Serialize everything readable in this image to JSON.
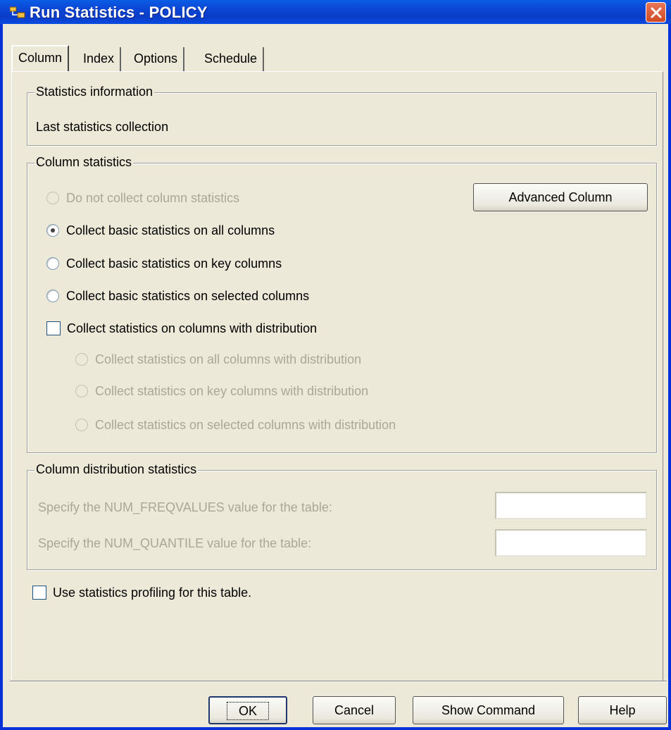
{
  "window": {
    "title": "Run Statistics - POLICY",
    "close_icon": "close-x"
  },
  "tabs": [
    {
      "label": "Column",
      "active": true
    },
    {
      "label": "Index",
      "active": false
    },
    {
      "label": "Options",
      "active": false
    },
    {
      "label": "Schedule",
      "active": false
    }
  ],
  "statistics_info": {
    "legend": "Statistics information",
    "text": "Last statistics collection"
  },
  "column_stats": {
    "legend": "Column statistics",
    "advanced_button": "Advanced Column",
    "options": [
      {
        "label": "Do not collect column statistics",
        "checked": false,
        "enabled": false
      },
      {
        "label": "Collect basic statistics on all columns",
        "checked": true,
        "enabled": true
      },
      {
        "label": "Collect basic statistics on key columns",
        "checked": false,
        "enabled": true
      },
      {
        "label": "Collect basic statistics on selected columns",
        "checked": false,
        "enabled": true
      }
    ],
    "distribution_checkbox": "Collect statistics on columns with distribution",
    "distribution_options": [
      {
        "label": "Collect statistics on all columns with distribution",
        "enabled": false
      },
      {
        "label": "Collect statistics on key columns with distribution",
        "enabled": false
      },
      {
        "label": "Collect statistics on selected columns with distribution",
        "enabled": false
      }
    ]
  },
  "distribution_stats": {
    "legend": "Column distribution statistics",
    "freqvalues_label": "Specify the NUM_FREQVALUES value for the table:",
    "freqvalues_value": "",
    "quantile_label": "Specify the NUM_QUANTILE value for the table:",
    "quantile_value": ""
  },
  "profiling_checkbox": "Use statistics profiling for this table.",
  "buttons": {
    "ok": "OK",
    "cancel": "Cancel",
    "show_command": "Show Command",
    "help": "Help"
  },
  "colors": {
    "titlebar": "#0a4ae0",
    "dialog_bg": "#ece9d8",
    "disabled_text": "#a9a796",
    "close_button": "#d14a24"
  }
}
